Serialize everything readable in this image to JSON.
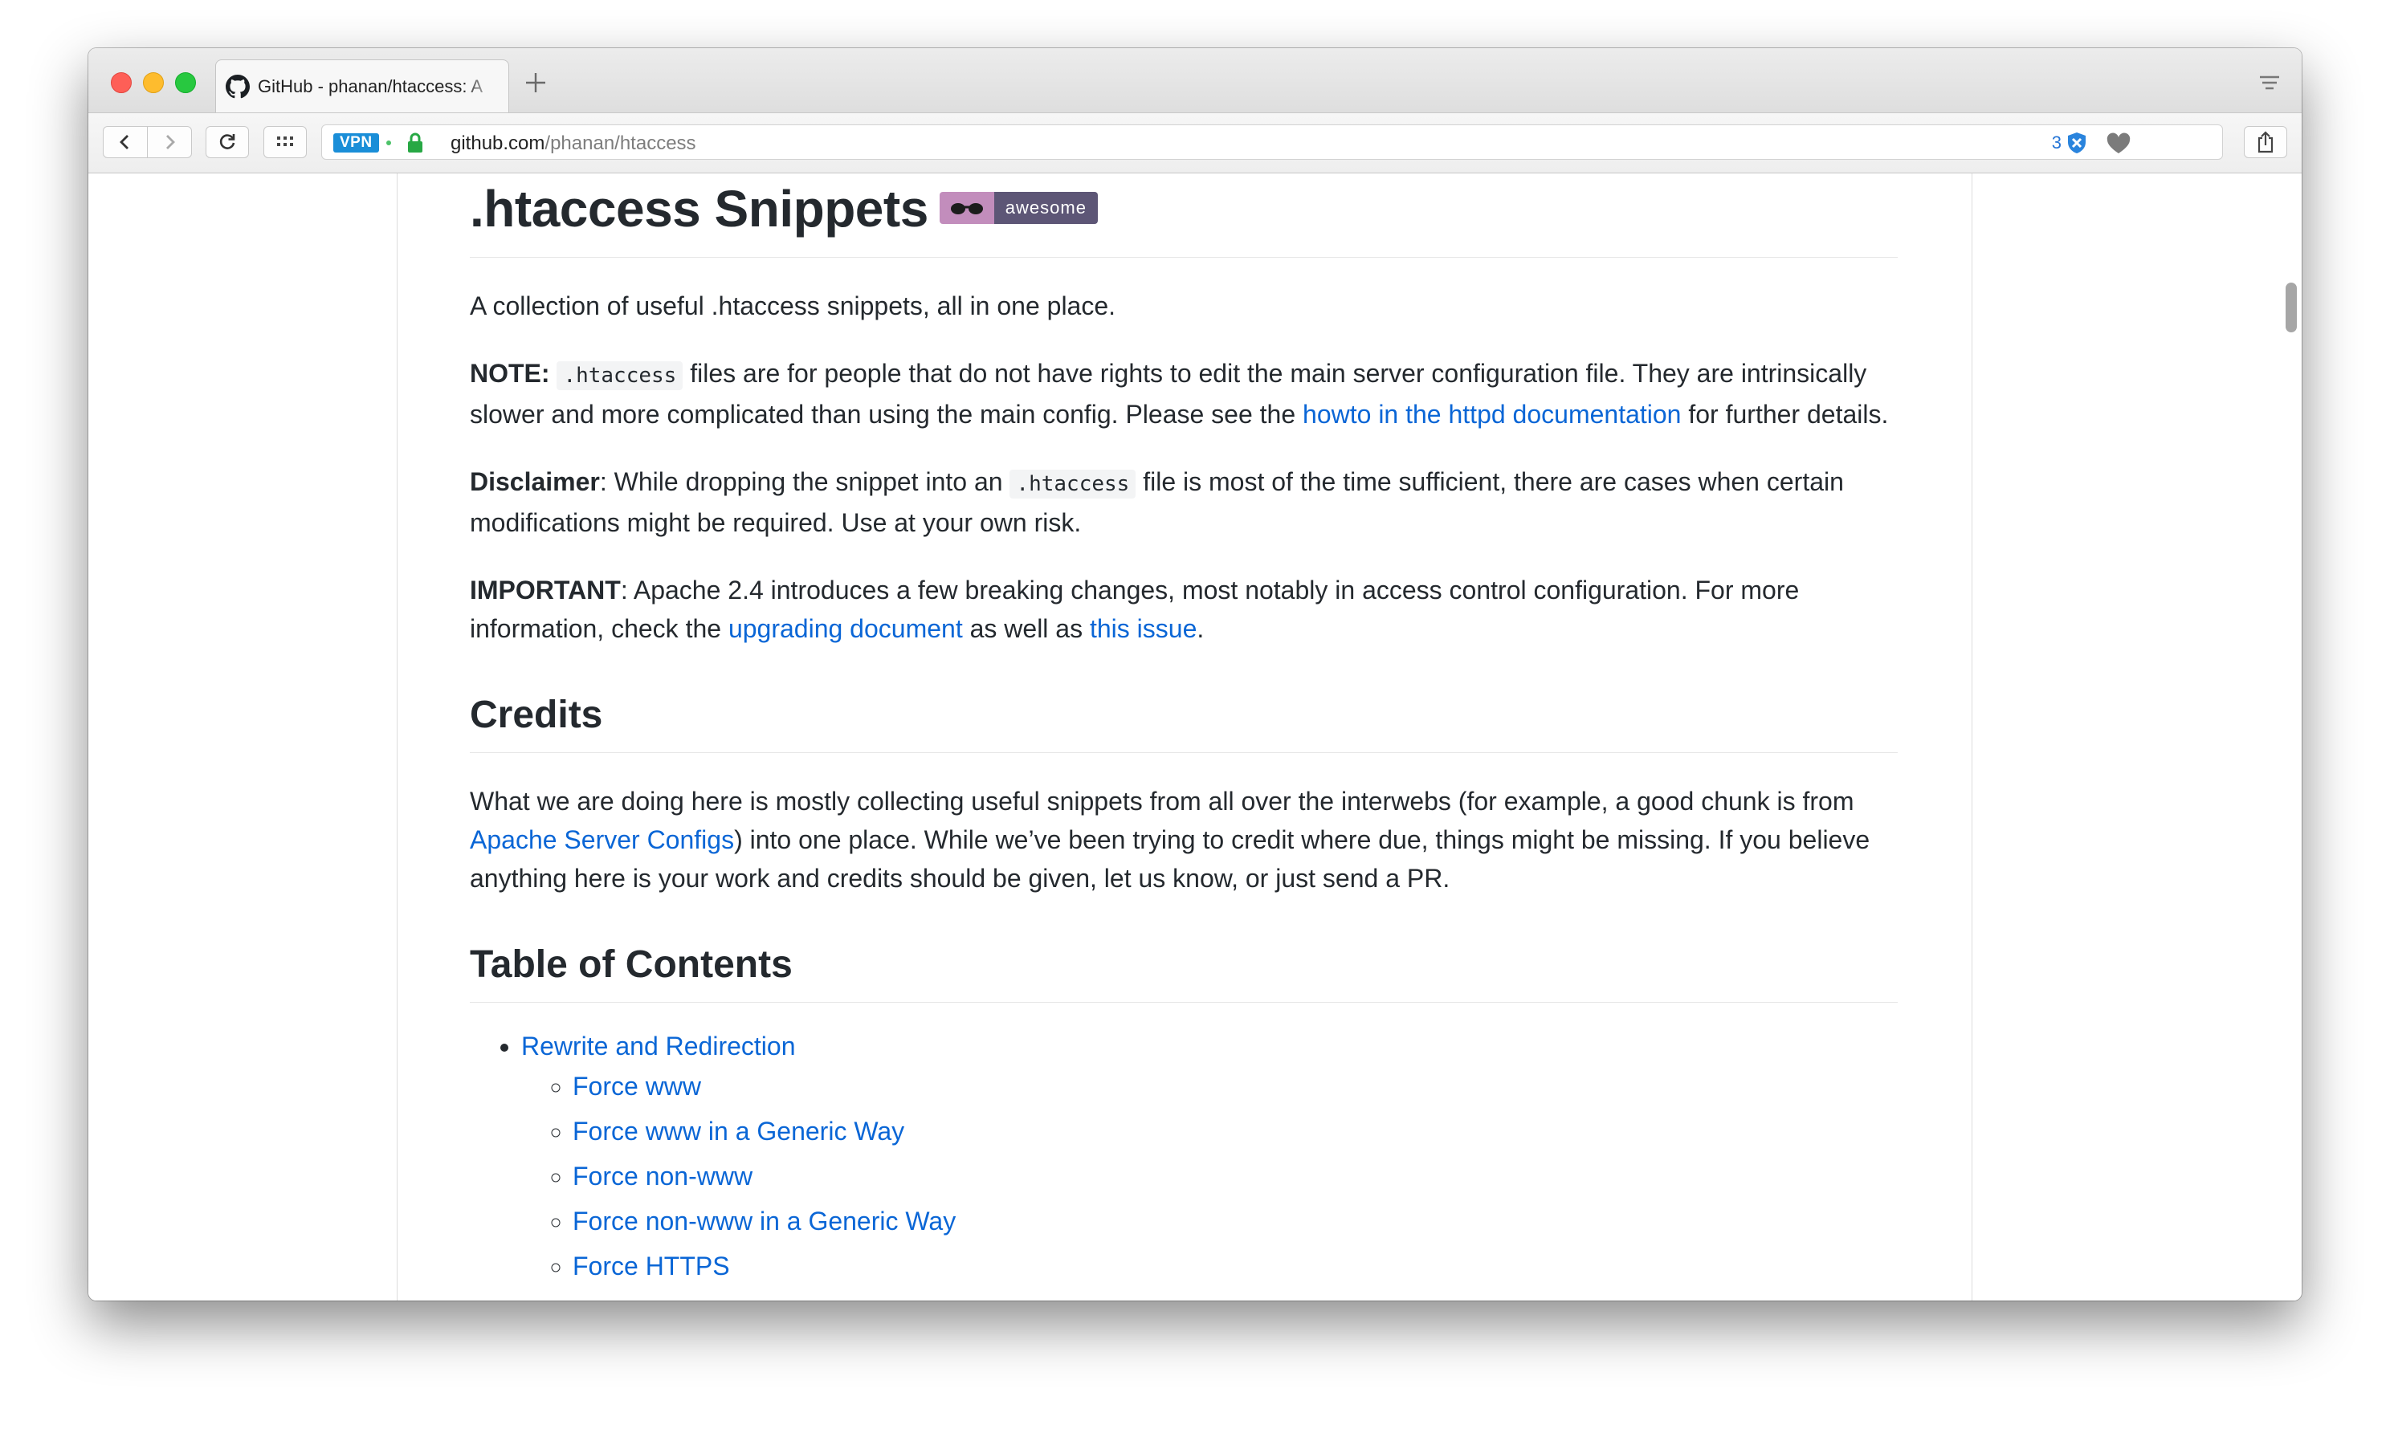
{
  "browser": {
    "tab_title": "GitHub - phanan/htaccess: A",
    "new_tab_symbol": "+",
    "vpn_label": "VPN",
    "url_host": "github.com",
    "url_path": "/phanan/htaccess",
    "extension_count": "3"
  },
  "article": {
    "title": ".htaccess Snippets",
    "badge_text": "awesome",
    "intro": "A collection of useful .htaccess snippets, all in one place.",
    "note": {
      "label": "NOTE:",
      "code": ".htaccess",
      "text1": " files are for people that do not have rights to edit the main server configuration file. They are intrinsically slower and more complicated than using the main config. Please see the ",
      "link": "howto in the httpd documentation",
      "text2": " for further details."
    },
    "disclaimer": {
      "label": "Disclaimer",
      "text1": ": While dropping the snippet into an ",
      "code": ".htaccess",
      "text2": " file is most of the time sufficient, there are cases when certain modifications might be required. Use at your own risk."
    },
    "important": {
      "label": "IMPORTANT",
      "text1": ": Apache 2.4 introduces a few breaking changes, most notably in access control configuration. For more information, check the ",
      "link1": "upgrading document",
      "text2": " as well as ",
      "link2": "this issue",
      "text3": "."
    },
    "credits": {
      "heading": "Credits",
      "text1": "What we are doing here is mostly collecting useful snippets from all over the interwebs (for example, a good chunk is from ",
      "link": "Apache Server Configs",
      "text2": ") into one place. While we’ve been trying to credit where due, things might be missing. If you believe anything here is your work and credits should be given, let us know, or just send a PR."
    },
    "toc": {
      "heading": "Table of Contents",
      "section": "Rewrite and Redirection",
      "items": [
        "Force www",
        "Force www in a Generic Way",
        "Force non-www",
        "Force non-www in a Generic Way",
        "Force HTTPS"
      ]
    }
  },
  "colors": {
    "link": "#0a66d6",
    "text": "#24292e",
    "vpn": "#1a8ed8",
    "badge_left": "#c28dbc",
    "badge_right": "#5d5676"
  }
}
